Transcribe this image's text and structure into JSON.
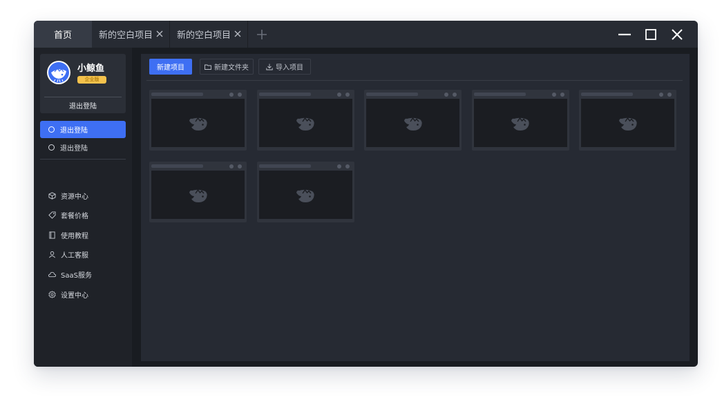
{
  "tabs": {
    "home": "首页",
    "items": [
      {
        "label": "新的空白项目"
      },
      {
        "label": "新的空白项目"
      }
    ]
  },
  "icons": {
    "tab_close": "close-icon",
    "tab_add": "plus-icon",
    "minimize": "minimize-icon",
    "maximize": "maximize-icon",
    "close": "close-icon"
  },
  "user": {
    "name": "小鲸鱼",
    "badge": "企业版",
    "logout": "退出登陆"
  },
  "sidebar": {
    "primary": [
      {
        "label": "退出登陆",
        "active": true
      },
      {
        "label": "退出登陆",
        "active": false
      }
    ],
    "secondary": [
      {
        "label": "资源中心",
        "icon": "cube-icon"
      },
      {
        "label": "套餐价格",
        "icon": "tag-icon"
      },
      {
        "label": "使用教程",
        "icon": "book-icon"
      },
      {
        "label": "人工客服",
        "icon": "user-icon"
      },
      {
        "label": "SaaS服务",
        "icon": "cloud-icon"
      },
      {
        "label": "设置中心",
        "icon": "gear-icon"
      }
    ]
  },
  "toolbar": {
    "new_project": "新建项目",
    "new_folder": "新建文件夹",
    "import_project": "导入项目"
  },
  "projects_count": 7,
  "colors": {
    "accent": "#3e6ff3",
    "badge": "#f5c24c",
    "window_bg": "#191c21",
    "main_bg": "#262a33"
  }
}
